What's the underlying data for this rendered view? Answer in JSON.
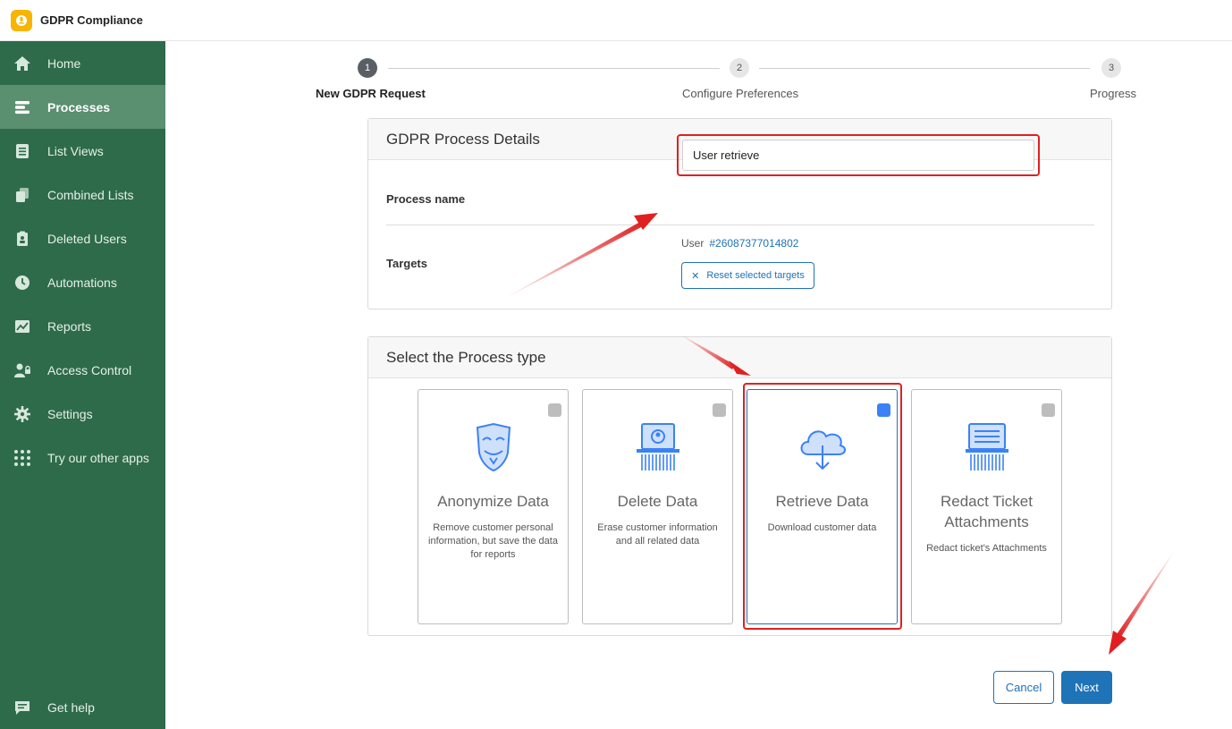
{
  "app": {
    "title": "GDPR Compliance"
  },
  "sidebar": {
    "items": [
      {
        "label": "Home",
        "icon": "home-icon"
      },
      {
        "label": "Processes",
        "icon": "processes-icon",
        "active": true
      },
      {
        "label": "List Views",
        "icon": "list-views-icon"
      },
      {
        "label": "Combined Lists",
        "icon": "combined-lists-icon"
      },
      {
        "label": "Deleted Users",
        "icon": "deleted-users-icon"
      },
      {
        "label": "Automations",
        "icon": "clock-icon"
      },
      {
        "label": "Reports",
        "icon": "chart-icon"
      },
      {
        "label": "Access Control",
        "icon": "access-control-icon"
      },
      {
        "label": "Settings",
        "icon": "gear-icon"
      },
      {
        "label": "Try our other apps",
        "icon": "apps-grid-icon"
      }
    ],
    "help": {
      "label": "Get help",
      "icon": "chat-icon"
    }
  },
  "stepper": {
    "steps": [
      {
        "number": "1",
        "label": "New GDPR Request",
        "active": true
      },
      {
        "number": "2",
        "label": "Configure Preferences"
      },
      {
        "number": "3",
        "label": "Progress"
      }
    ]
  },
  "details": {
    "title": "GDPR Process Details",
    "process_name_label": "Process name",
    "process_name_value": "User retrieve",
    "targets_label": "Targets",
    "target_type": "User",
    "target_id": "#26087377014802",
    "reset_label": "Reset selected targets"
  },
  "process_type": {
    "title": "Select the Process type",
    "cards": [
      {
        "title": "Anonymize Data",
        "desc": "Remove customer personal information, but save the data for reports",
        "icon": "mask-icon"
      },
      {
        "title": "Delete Data",
        "desc": "Erase customer information and all related data",
        "icon": "shredder-icon"
      },
      {
        "title": "Retrieve Data",
        "desc": "Download customer data",
        "icon": "cloud-download-icon",
        "selected": true
      },
      {
        "title": "Redact Ticket Attachments",
        "desc": "Redact ticket's Attachments",
        "icon": "document-shredder-icon"
      }
    ]
  },
  "footer": {
    "cancel_label": "Cancel",
    "next_label": "Next"
  },
  "colors": {
    "sidebar": "#2e6b4a",
    "sidebar_active": "#5a8f70",
    "primary": "#1f73b7",
    "annotation": "#e02020",
    "logo": "#f7b500"
  }
}
